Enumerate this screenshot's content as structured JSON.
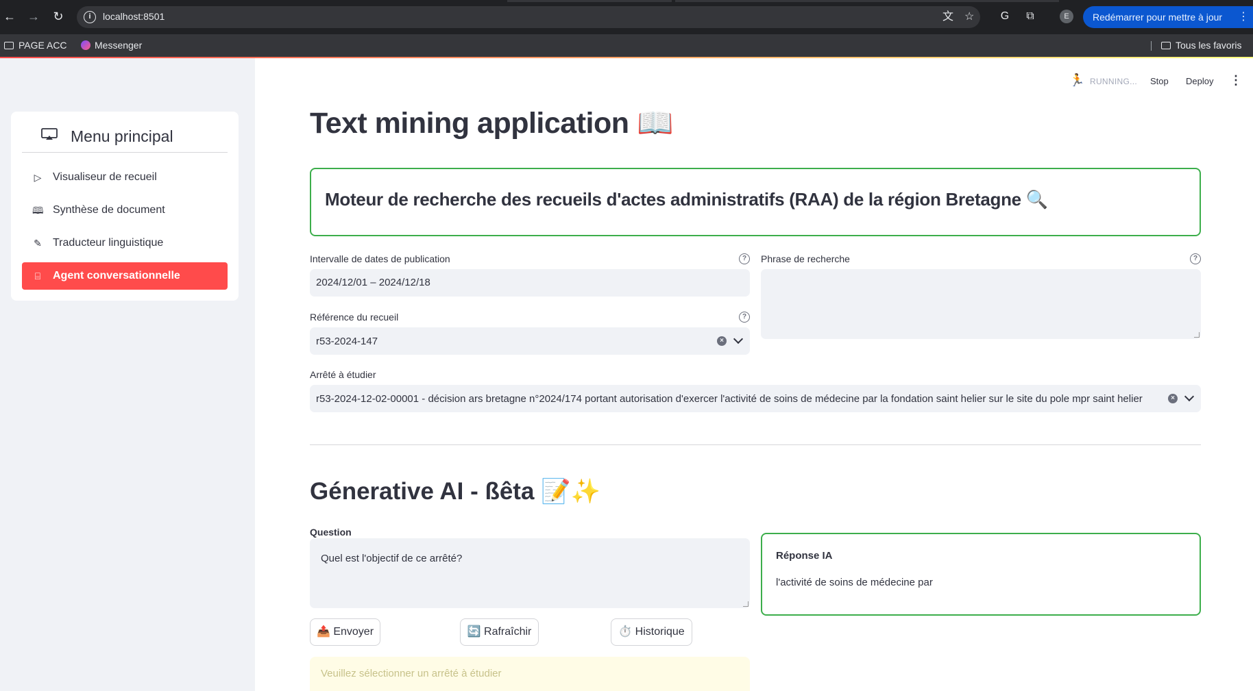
{
  "browser": {
    "url": "localhost:8501",
    "restart_label": "Redémarrer pour mettre à jour",
    "avatar_letter": "E",
    "bookmarks": [
      {
        "label": "PAGE ACC"
      },
      {
        "label": "Messenger"
      }
    ],
    "all_bookmarks_label": "Tous les favoris"
  },
  "sidebar": {
    "title": "Menu principal",
    "items": [
      {
        "label": "Visualiseur de recueil",
        "icon": "play-icon"
      },
      {
        "label": "Synthèse de document",
        "icon": "book-icon"
      },
      {
        "label": "Traducteur linguistique",
        "icon": "pencil-icon"
      },
      {
        "label": "Agent conversationnelle",
        "icon": "robot-icon",
        "active": true
      }
    ],
    "accent_color": "#ff4b4b"
  },
  "toolbar": {
    "status": "RUNNING...",
    "stop_label": "Stop",
    "deploy_label": "Deploy"
  },
  "page": {
    "title": "Text mining application 📖",
    "search_banner": "Moteur de recherche des recueils d'actes administratifs (RAA) de la région Bretagne 🔍",
    "date_label": "Intervalle de dates de publication",
    "date_value": "2024/12/01 – 2024/12/18",
    "phrase_label": "Phrase de recherche",
    "phrase_value": "",
    "ref_label": "Référence du recueil",
    "ref_value": "r53-2024-147",
    "arrete_label": "Arrêté à étudier",
    "arrete_value": "r53-2024-12-02-00001 - décision ars bretagne n°2024/174 portant autorisation d'exercer l'activité de soins de médecine par la fondation saint helier sur le site du pole mpr saint helier",
    "genai_title": "Génerative AI - ßêta 📝✨",
    "question_label": "Question",
    "question_value": "Quel est l'objectif de ce arrêté?",
    "answer_title": "Réponse IA",
    "answer_text": "l'activité de soins de médecine par",
    "send_label": "📤 Envoyer",
    "refresh_label": "🔄 Rafraîchir",
    "history_label": "⏱️ Historique",
    "warning_text": "Veuillez sélectionner un arrêté à étudier",
    "success_border_color": "#3cae4b"
  }
}
